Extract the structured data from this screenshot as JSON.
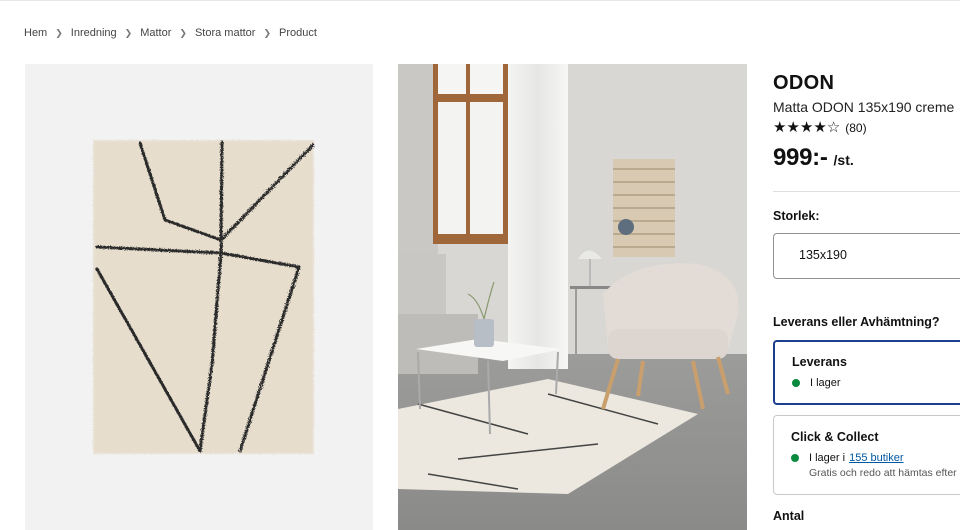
{
  "breadcrumb": {
    "items": [
      "Hem",
      "Inredning",
      "Mattor",
      "Stora mattor",
      "Product"
    ]
  },
  "product": {
    "name": "ODON",
    "description": "Matta ODON 135x190 creme",
    "rating": 4,
    "rating_max": 5,
    "review_count": "(80)",
    "price": "999:-",
    "price_unit": "/st."
  },
  "size": {
    "label": "Storlek:",
    "value": "135x190"
  },
  "delivery": {
    "label": "Leverans eller Avhämtning?",
    "options": [
      {
        "title": "Leverans",
        "status": "I lager",
        "status_color": "#0a8a3c"
      },
      {
        "title": "Click & Collect",
        "status_prefix": "I lager i",
        "status_link": "155 butiker",
        "note": "Gratis och redo att hämtas efter",
        "status_color": "#0a8a3c"
      }
    ]
  },
  "quantity": {
    "label": "Antal"
  },
  "colors": {
    "accent": "#1d3f8f",
    "link": "#0058a3",
    "in_stock": "#0a8a3c"
  }
}
